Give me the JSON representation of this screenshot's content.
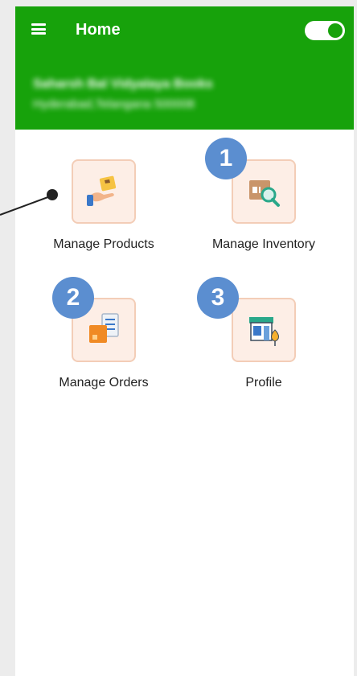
{
  "app_bar": {
    "title": "Home",
    "menu_icon": "hamburger-menu-icon",
    "toggle_state": "on",
    "accent_color": "#17a20b"
  },
  "store": {
    "name": "Saharsh Bal Vidyalaya Books",
    "address": "Hyderabad,Telangana 500008"
  },
  "tiles": [
    {
      "label": "Manage Products",
      "icon": "hand-with-box-icon"
    },
    {
      "label": "Manage Inventory",
      "icon": "box-with-magnifier-icon"
    },
    {
      "label": "Manage Orders",
      "icon": "box-with-clipboard-icon"
    },
    {
      "label": "Profile",
      "icon": "storefront-icon"
    }
  ],
  "annotations": {
    "badges": [
      "1",
      "2",
      "3"
    ],
    "badge_color": "#5b8ed0"
  }
}
